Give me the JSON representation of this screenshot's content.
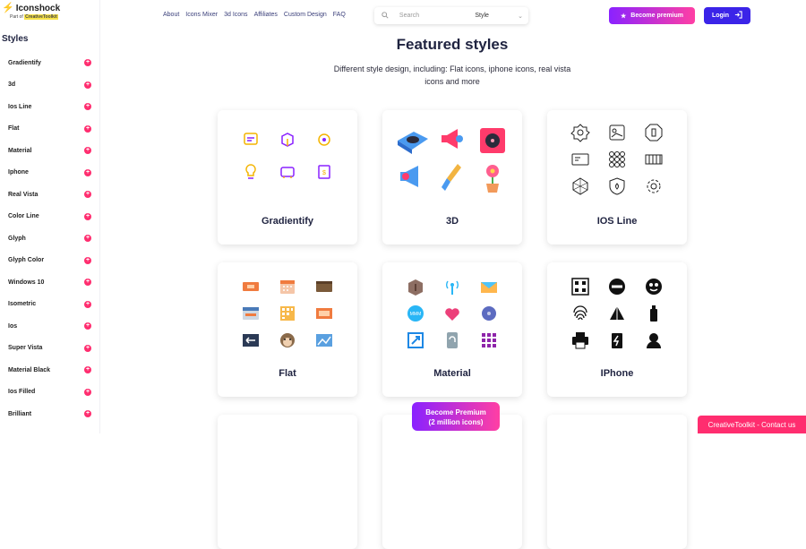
{
  "brand": {
    "name": "Iconshock",
    "sub_prefix": "Part of",
    "sub_brand": "CreativeToolkit"
  },
  "sidebar": {
    "title": "Styles",
    "items": [
      "Gradientify",
      "3d",
      "Ios Line",
      "Flat",
      "Material",
      "Iphone",
      "Real Vista",
      "Color Line",
      "Glyph",
      "Glyph Color",
      "Windows 10",
      "Isometric",
      "Ios",
      "Super Vista",
      "Material Black",
      "Ios Filled",
      "Brilliant"
    ]
  },
  "nav": {
    "items": [
      "About",
      "Icons Mixer",
      "3d Icons",
      "Affiliates",
      "Custom Design",
      "FAQ"
    ]
  },
  "search": {
    "placeholder": "Search",
    "style_label": "Style"
  },
  "header": {
    "premium_label": "Become premium",
    "login_label": "Login"
  },
  "main": {
    "title": "Featured styles",
    "subtitle": "Different style design, including: Flat icons, iphone icons, real vista icons and more",
    "cards": [
      "Gradientify",
      "3D",
      "IOS Line",
      "Flat",
      "Material",
      "IPhone"
    ]
  },
  "floating": {
    "premium_line1": "Become Premium",
    "premium_line2": "(2 million icons)"
  },
  "footer": {
    "contact_label": "CreativeToolkit - Contact us"
  },
  "colors": {
    "accent": "#ff2d6f",
    "login": "#3b24e8",
    "gradient_start": "#8a22ff",
    "gradient_end": "#ff3fa4"
  }
}
